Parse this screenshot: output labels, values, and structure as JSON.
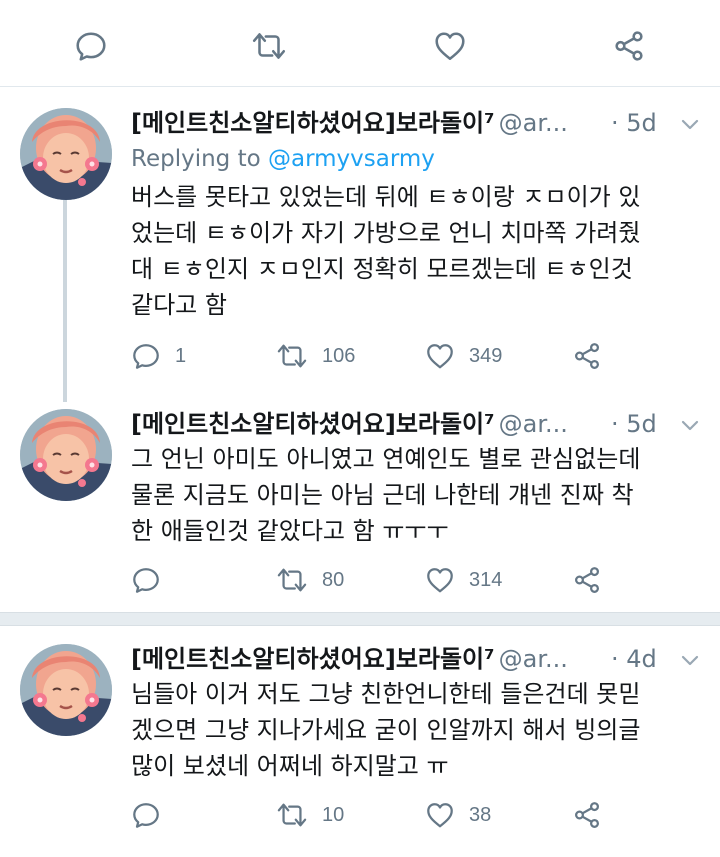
{
  "tweets": [
    {
      "name": "[메인트친소알티하셨어요]보라돌이⁷",
      "handle": "@ar...",
      "time": "· 5d",
      "reply_prefix": "Replying to",
      "reply_mention": "@armyvsarmy",
      "lines": [
        "버스를 못타고 있었는데 뒤에 ㅌㅎ이랑 ㅈㅁ이가 있",
        "었는데 ㅌㅎ이가 자기 가방으로 언니 치마쪽 가려줬",
        "대 ㅌㅎ인지 ㅈㅁ인지 정확히 모르겠는데 ㅌㅎ인것",
        "같다고 함"
      ],
      "replies": "1",
      "retweets": "106",
      "likes": "349"
    },
    {
      "name": "[메인트친소알티하셨어요]보라돌이⁷",
      "handle": "@ar...",
      "time": "· 5d",
      "lines": [
        "그 언닌 아미도 아니였고 연예인도 별로 관심없는데",
        "물론 지금도 아미는 아님 근데 나한테 걔넨 진짜 착",
        "한 애들인것 같았다고 함 ㅠㅜㅜ"
      ],
      "replies": "",
      "retweets": "80",
      "likes": "314"
    },
    {
      "name": "[메인트친소알티하셨어요]보라돌이⁷",
      "handle": "@ar...",
      "time": "· 4d",
      "lines": [
        "님들아 이거 저도 그냥 친한언니한테 들은건데 못믿",
        "겠으면 그냥 지나가세요 굳이 인알까지 해서 빙의글",
        "많이 보셨네 어쩌네 하지말고 ㅠ"
      ],
      "replies": "",
      "retweets": "10",
      "likes": "38"
    }
  ],
  "icons": {
    "reply": "reply-icon",
    "retweet": "retweet-icon",
    "like": "heart-icon",
    "share": "share-icon",
    "caret": "chevron-down-icon"
  },
  "colors": {
    "icon_gray": "#657786",
    "link_blue": "#1da1f2",
    "separator": "#e1e8ed",
    "thread_line": "#ccd6dd"
  }
}
